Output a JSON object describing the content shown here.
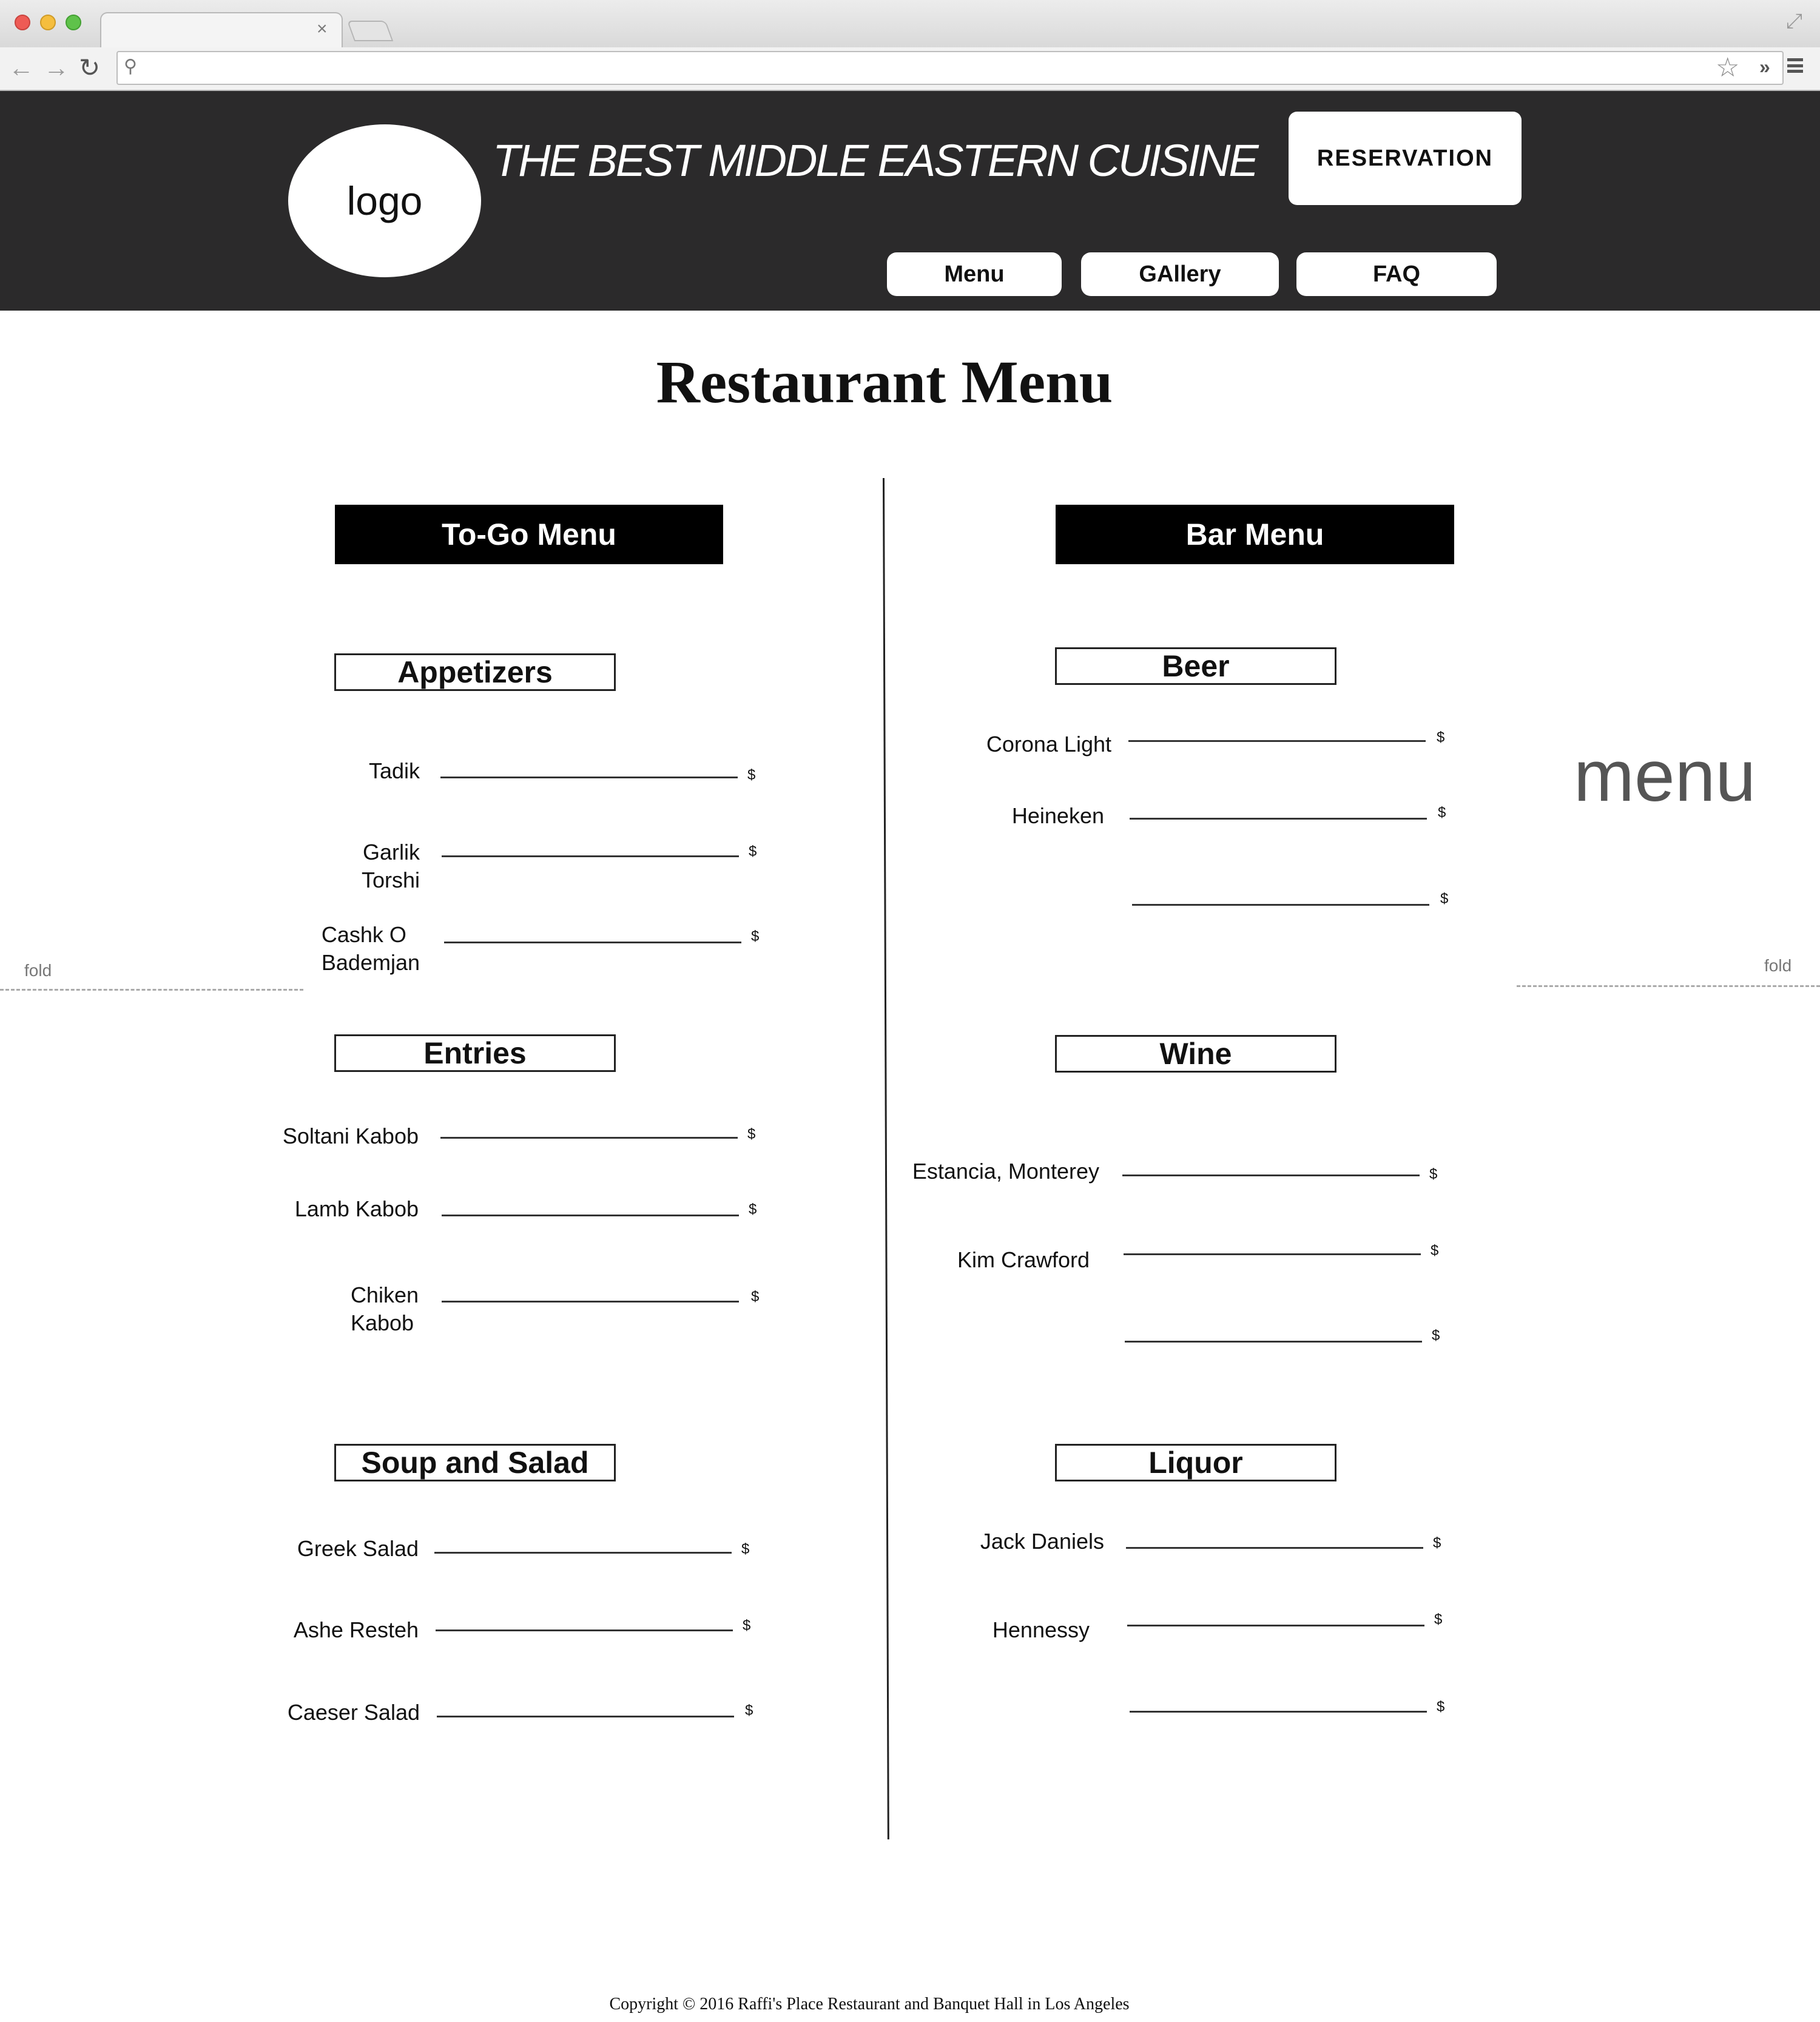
{
  "browser": {
    "tab_close": "×",
    "back": "←",
    "forward": "→",
    "reload": "↻",
    "search_icon": "⚲",
    "star": "☆",
    "extensions": "»",
    "resize": "⤢"
  },
  "header": {
    "logo_text": "logo",
    "tagline": "THE BEST MIDDLE EASTERN CUISINE",
    "reservation_label": "RESERVATION",
    "nav": [
      "Menu",
      "GAllery",
      "FAQ"
    ]
  },
  "page_title": "Restaurant Menu",
  "togo_menu": {
    "title": "To-Go Menu",
    "categories": [
      {
        "name": "Appetizers",
        "items": [
          {
            "name": "Tadik",
            "price": "$"
          },
          {
            "name": "Garlik\nTorshi",
            "price": "$"
          },
          {
            "name": "Cashk O\nBademjan",
            "price": "$"
          }
        ]
      },
      {
        "name": "Entries",
        "items": [
          {
            "name": "Soltani Kabob",
            "price": "$"
          },
          {
            "name": "Lamb Kabob",
            "price": "$"
          },
          {
            "name": "Chiken\nKabob",
            "price": "$"
          }
        ]
      },
      {
        "name": "Soup and Salad",
        "items": [
          {
            "name": "Greek Salad",
            "price": "$"
          },
          {
            "name": "Ashe Resteh",
            "price": "$"
          },
          {
            "name": "Caeser Salad",
            "price": "$"
          }
        ]
      }
    ]
  },
  "bar_menu": {
    "title": "Bar Menu",
    "categories": [
      {
        "name": "Beer",
        "items": [
          {
            "name": "Corona Light",
            "price": "$"
          },
          {
            "name": "Heineken",
            "price": "$"
          },
          {
            "name": "",
            "price": "$"
          }
        ]
      },
      {
        "name": "Wine",
        "items": [
          {
            "name": "Estancia, Monterey",
            "price": "$"
          },
          {
            "name": "Kim Crawford",
            "price": "$"
          },
          {
            "name": "",
            "price": "$"
          }
        ]
      },
      {
        "name": "Liquor",
        "items": [
          {
            "name": "Jack Daniels",
            "price": "$"
          },
          {
            "name": "Hennessy",
            "price": "$"
          },
          {
            "name": "",
            "price": "$"
          }
        ]
      }
    ]
  },
  "side_label": "menu",
  "fold_label": "fold",
  "footer": "Copyright © 2016 Raffi's Place Restaurant and Banquet Hall in Los Angeles"
}
